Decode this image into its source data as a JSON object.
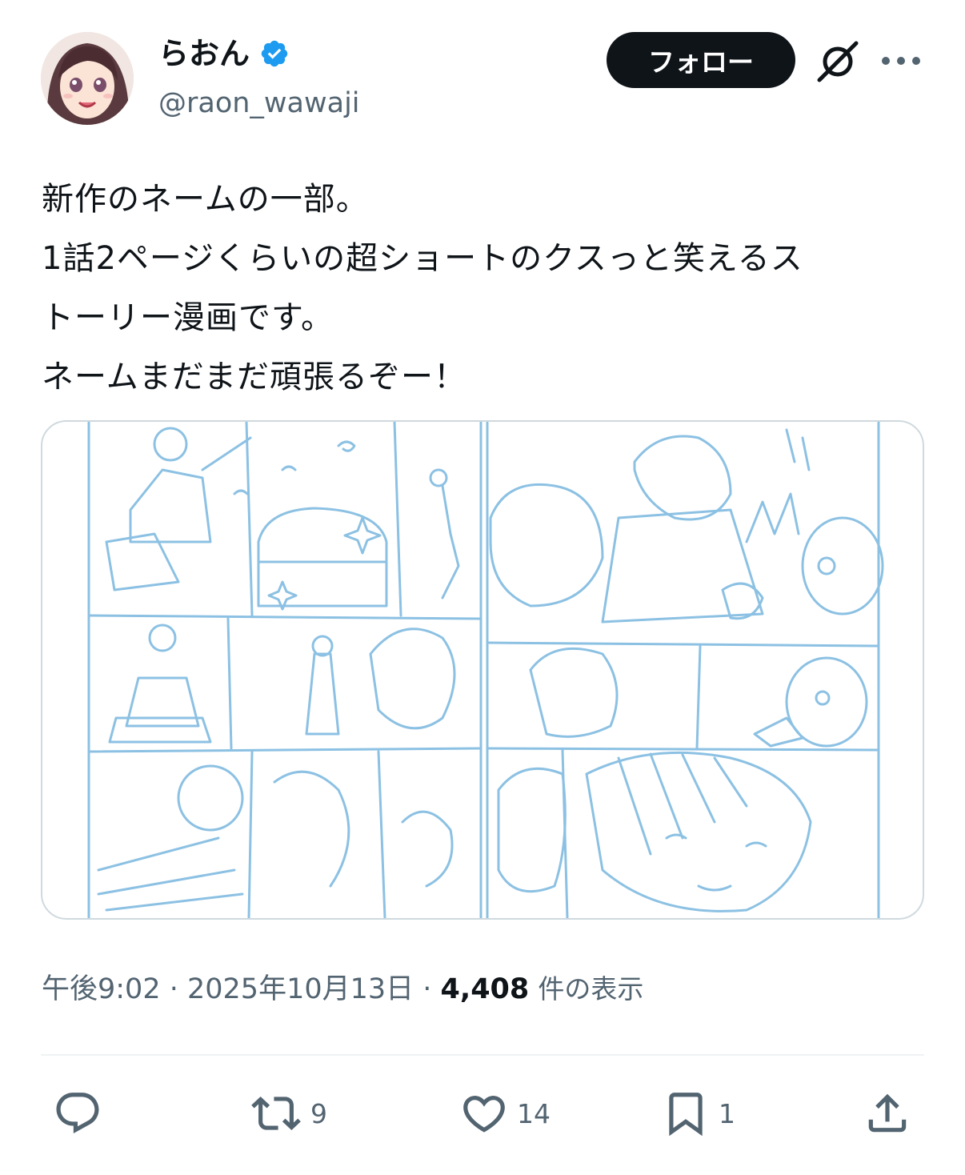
{
  "author": {
    "display_name": "らおん",
    "handle": "@raon_wawaji",
    "verified": true,
    "verified_color": "#1d9bf0"
  },
  "follow_button": {
    "label": "フォロー"
  },
  "icons": {
    "grok": "grok-icon",
    "more": "more-icon",
    "reply": "reply-icon",
    "retweet": "retweet-icon",
    "like": "heart-icon",
    "bookmark": "bookmark-icon",
    "share": "share-icon"
  },
  "tweet": {
    "lines": [
      "新作のネームの一部。",
      "1話2ページくらいの超ショートのクスっと笑えるス",
      "トーリー漫画です。",
      "ネームまだまだ頑張るぞー！"
    ]
  },
  "media": {
    "sketch_color": "#8cc1e3"
  },
  "meta": {
    "time": "午後9:02",
    "separator": " · ",
    "date": "2025年10月13日",
    "views_count": "4,408",
    "views_label": "件の表示"
  },
  "actions": {
    "retweets": "9",
    "likes": "14",
    "bookmarks": "1"
  }
}
